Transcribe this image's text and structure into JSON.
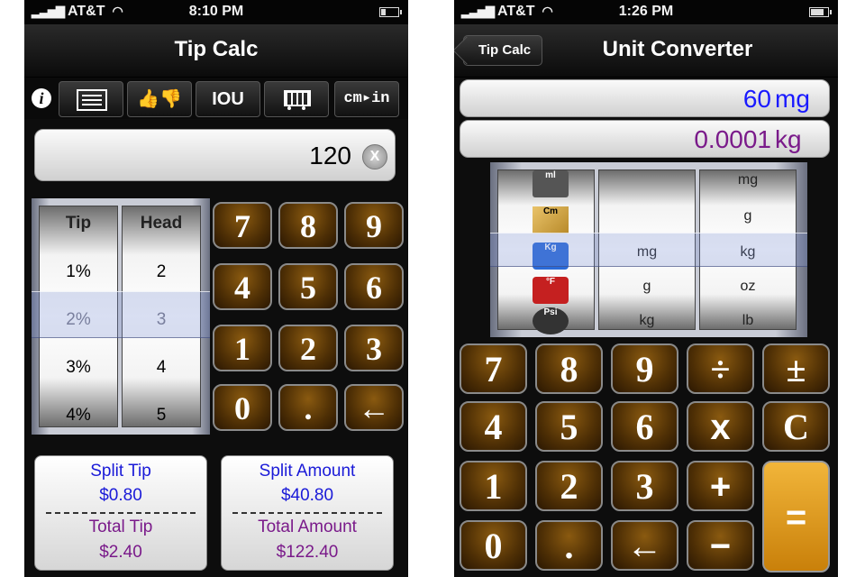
{
  "left": {
    "status": {
      "carrier": "AT&T",
      "time": "8:10 PM"
    },
    "nav_title": "Tip Calc",
    "toolbar": {
      "iou": "IOU",
      "units": "cm▸in"
    },
    "display_value": "120",
    "picker": {
      "tip_header": "Tip",
      "head_header": "Head",
      "tips": [
        "1%",
        "2%",
        "3%",
        "4%"
      ],
      "heads": [
        "2",
        "3",
        "4",
        "5"
      ]
    },
    "keypad": [
      "7",
      "8",
      "9",
      "4",
      "5",
      "6",
      "1",
      "2",
      "3",
      "0",
      ".",
      "←"
    ],
    "split_card": {
      "title1": "Split Tip",
      "value1": "$0.80",
      "title2": "Total Tip",
      "value2": "$2.40"
    },
    "amount_card": {
      "title1": "Split Amount",
      "value1": "$40.80",
      "title2": "Total Amount",
      "value2": "$122.40"
    }
  },
  "right": {
    "status": {
      "carrier": "AT&T",
      "time": "1:26 PM"
    },
    "back_label": "Tip Calc",
    "nav_title": "Unit Converter",
    "input": {
      "value": "60",
      "unit": "mg",
      "color": "#1a1aff"
    },
    "output": {
      "value": "0.0001",
      "unit": "kg",
      "color": "#7a1a8a"
    },
    "picker": {
      "icons": [
        "ml",
        "Cm",
        "Kg",
        "°F",
        "Psi"
      ],
      "from_units": [
        "mg",
        "g",
        "kg"
      ],
      "to_units": [
        "mg",
        "g",
        "kg",
        "oz",
        "lb"
      ]
    },
    "keypad": [
      "7",
      "8",
      "9",
      "÷",
      "±",
      "4",
      "5",
      "6",
      "x",
      "C",
      "1",
      "2",
      "3",
      "+",
      "=",
      "0",
      ".",
      "←",
      "−"
    ]
  }
}
